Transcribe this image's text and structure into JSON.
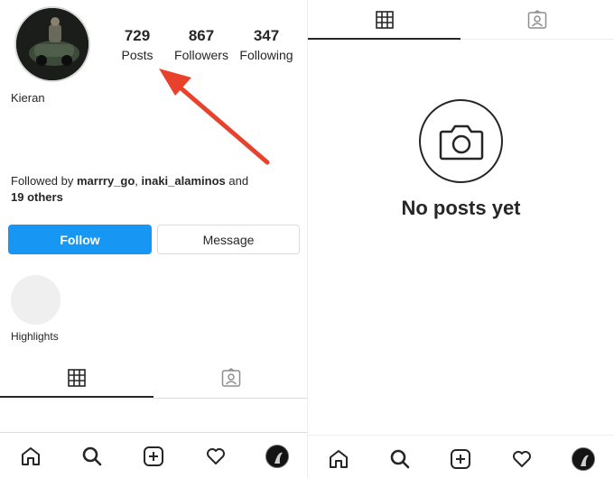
{
  "profile": {
    "username": "Kieran",
    "stats": [
      {
        "value": "729",
        "label": "Posts"
      },
      {
        "value": "867",
        "label": "Followers"
      },
      {
        "value": "347",
        "label": "Following"
      }
    ],
    "followed_by": {
      "prefix": "Followed by ",
      "user1": "marrry_go",
      "sep": ", ",
      "user2": "inaki_alaminos",
      "and": " and",
      "others": "19 others"
    },
    "follow_label": "Follow",
    "message_label": "Message",
    "highlights_label": "Highlights"
  },
  "empty_state": {
    "title": "No posts yet"
  },
  "icons": {
    "grid": "grid-icon",
    "tagged": "tagged-icon",
    "camera": "camera-icon",
    "home": "home-icon",
    "search": "search-icon",
    "new_post": "plus-square-icon",
    "activity": "heart-icon",
    "profile": "avatar"
  },
  "colors": {
    "primary": "#1797f3",
    "arrow": "#e8412c",
    "text": "#262626",
    "border": "#dbdbdb"
  }
}
